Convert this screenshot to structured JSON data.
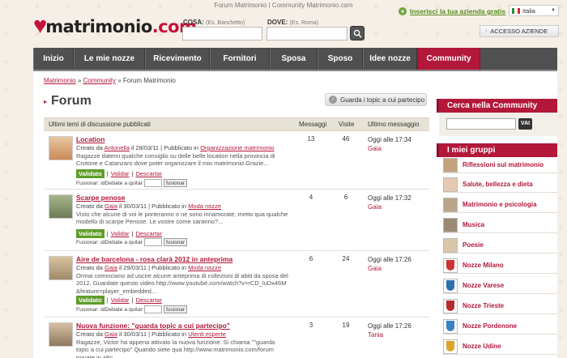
{
  "window_title": "Forum Matrimonio | Community Matrimonio.com",
  "logo": {
    "text_main": "matrimonio",
    "text_dom": ".com"
  },
  "search": {
    "cosa_label": "COSA:",
    "cosa_hint": "(Es. Banchetto)",
    "dove_label": "DOVE:",
    "dove_hint": "(Es. Roma)",
    "cosa_value": "",
    "dove_value": ""
  },
  "header": {
    "insert_link": "Inserisci la tua azienda gratis",
    "language": "Italia",
    "access_button": "ACCESSO AZIENDE"
  },
  "nav": [
    "Inizio",
    "Le mie nozze",
    "Ricevimento",
    "Fornitori",
    "Sposa",
    "Sposo",
    "Idee nozze",
    "Community"
  ],
  "breadcrumb": {
    "home": "Matrimonio",
    "sep1": "»",
    "community": "Community",
    "sep2": "»",
    "current": "Forum Matrimonio"
  },
  "page_title": "Forum",
  "guarda_button": "Guarda i topic a cui partecipo",
  "table": {
    "col_topics": "Ultimi temi di discussione pubblicati",
    "col_messages": "Messaggi",
    "col_visits": "Visite",
    "col_last": "Ultimo messaggio"
  },
  "topics": [
    {
      "title": "Location",
      "meta_prefix": "Creato da",
      "author": "Antonella",
      "meta_date": "il 28/03/11 | Pubblicato in",
      "category": "Organizzazione matrimonio",
      "excerpt": "Ragazze datemi qualche consiglio su delle belle location nella provincia di Crotone e Catanzaro dove poter organizzare il mio matrimonio.Grazie...",
      "messages": "13",
      "visits": "46",
      "last_when": "Oggi alle 17:34",
      "last_by": "Gaia",
      "validated": "Validato",
      "validate": "Validar",
      "discard": "Descartar",
      "fusion_label": "Fusionar: idDebate a quitar",
      "fusion_btn": "fusionar"
    },
    {
      "title": "Scarpe penose",
      "meta_prefix": "Creato da",
      "author": "Gaia",
      "meta_date": "il 30/03/11 | Pubblicato in",
      "category": "Moda nozze",
      "excerpt": "Visto che alcune di voi le porteranno o ne sono innamorate, metto qua qualche modello di scarpe Penose. Le vostre come saranno?...",
      "messages": "4",
      "visits": "6",
      "last_when": "Oggi alle 17:32",
      "last_by": "Gaia",
      "validated": "Validato",
      "validate": "Validar",
      "discard": "Descartar",
      "fusion_label": "Fusionar: idDebate a quitar",
      "fusion_btn": "fusionar"
    },
    {
      "title": "Aire de barcelona - rosa clarà 2012 in anteprima",
      "meta_prefix": "Creato da",
      "author": "Gaia",
      "meta_date": "il 29/03/11 | Pubblicato in",
      "category": "Moda nozze",
      "excerpt": "Ormai cominciano ad uscire alcune anteprima di collezioni di abiti da sposa del 2012. Guardate questo video http://www.youtube.com/watch?v=rCD_luDx46M&feature=player_embedded...",
      "messages": "6",
      "visits": "24",
      "last_when": "Oggi alle 17:26",
      "last_by": "Gaia",
      "validated": "Validato",
      "validate": "Validar",
      "discard": "Descartar",
      "fusion_label": "Fusionar: idDebate a quitar",
      "fusion_btn": "fusionar"
    },
    {
      "title": "Nuova funzione: \"guarda topic a cui partecipo\"",
      "meta_prefix": "Creato da",
      "author": "Gaia",
      "meta_date": "il 30/03/11 | Pubblicato in",
      "category": "Utenti esperte",
      "excerpt": "Ragazze, Victor ha appena attivato la nuova funzione. Si chiama \"\"guarda topic a cui partecipo\" Quando siete qua http://www.matrimonio.com/forum trovate in alto...",
      "messages": "3",
      "visits": "19",
      "last_when": "Oggi alle 17:26",
      "last_by": "Tania"
    }
  ],
  "sidebar": {
    "search_title": "Cerca nella Community",
    "search_button": "VAI",
    "groups_title": "I miei gruppi",
    "groups": [
      "Riflessioni sul matrimonio",
      "Salute, bellezza e dieta",
      "Matrimonio e psicologia",
      "Musica",
      "Poesie",
      "Nozze Milano",
      "Nozze Varese",
      "Nozze Trieste",
      "Nozze Pordenone",
      "Nozze Udine"
    ]
  },
  "colors": {
    "brand": "#b3173a",
    "nav": "#505050",
    "validated": "#5f9d2a"
  }
}
